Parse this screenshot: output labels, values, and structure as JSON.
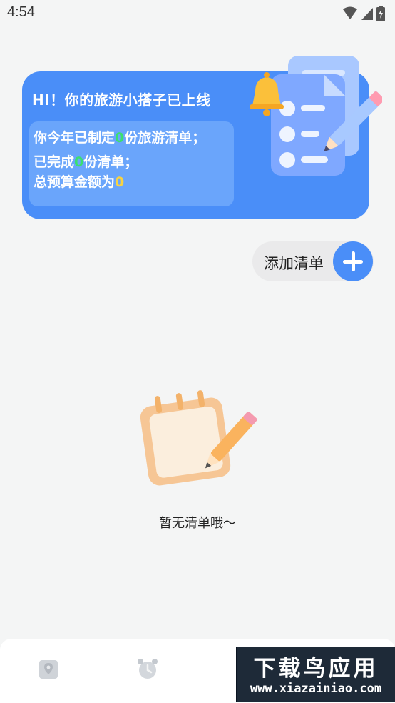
{
  "status_bar": {
    "time": "4:54"
  },
  "banner": {
    "title": "HI！你的旅游小搭子已上线",
    "line1_prefix": "你今年已制定",
    "line1_count": "0",
    "line1_suffix": "份旅游清单；",
    "line2_prefix": "已完成",
    "line2_count": "0",
    "line2_suffix": "份清单；",
    "line3_prefix": "总预算金额为",
    "line3_amount": "0"
  },
  "add_button": {
    "label": "添加清单"
  },
  "empty_state": {
    "message": "暂无清单哦～"
  },
  "tabbar": {
    "tabs": [
      {
        "icon": "map-pin-icon"
      },
      {
        "icon": "alarm-clock-icon"
      }
    ]
  },
  "watermark": {
    "title": "下载鸟应用",
    "url": "www.xiazainiao.com"
  },
  "colors": {
    "accent": "#4a8ef8",
    "background": "#f4f5f5"
  }
}
